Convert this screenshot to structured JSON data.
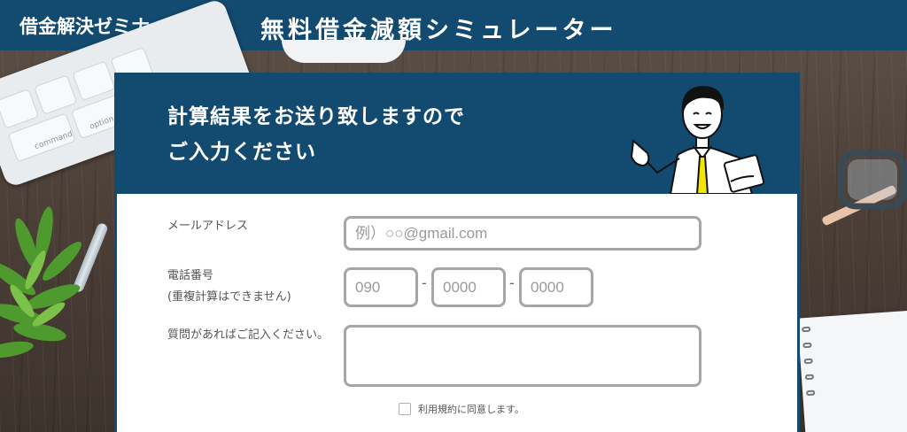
{
  "header": {
    "site_name": "借金解決ゼミナール",
    "title": "無料借金減額シミュレーター"
  },
  "decor": {
    "key_labels": [
      "command",
      "option"
    ]
  },
  "card": {
    "heading_line1": "計算結果をお送り致しますので",
    "heading_line2": "ご入力ください"
  },
  "form": {
    "email": {
      "label": "メールアドレス",
      "placeholder": "例）○○@gmail.com",
      "value": ""
    },
    "phone": {
      "label": "電話番号",
      "note": "(重複計算はできません)",
      "part1_placeholder": "090",
      "part2_placeholder": "0000",
      "part3_placeholder": "0000",
      "separator": "-"
    },
    "question": {
      "label": "質問があればご記入ください。",
      "value": ""
    },
    "agree": {
      "label": "利用規約に同意します。",
      "checked": false
    }
  },
  "colors": {
    "brand": "#124a70",
    "field_border": "#a6a6a6",
    "tie": "#f2e600"
  }
}
